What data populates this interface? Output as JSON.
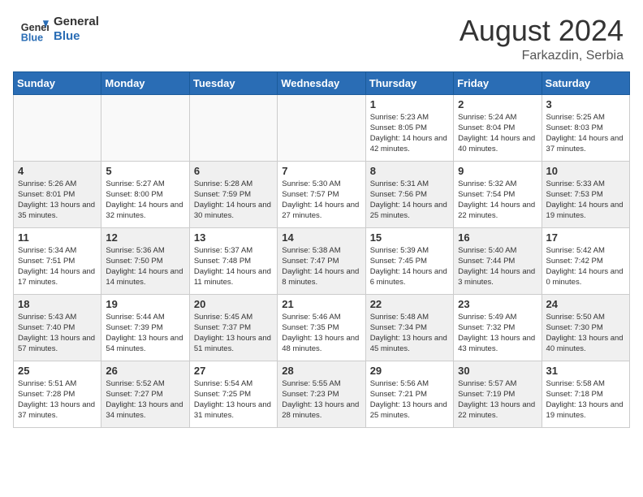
{
  "header": {
    "logo_line1": "General",
    "logo_line2": "Blue",
    "month_year": "August 2024",
    "location": "Farkazdin, Serbia"
  },
  "weekdays": [
    "Sunday",
    "Monday",
    "Tuesday",
    "Wednesday",
    "Thursday",
    "Friday",
    "Saturday"
  ],
  "weeks": [
    [
      {
        "day": "",
        "empty": true
      },
      {
        "day": "",
        "empty": true
      },
      {
        "day": "",
        "empty": true
      },
      {
        "day": "",
        "empty": true
      },
      {
        "day": "1",
        "sunrise": "5:23 AM",
        "sunset": "8:05 PM",
        "daylight": "14 hours and 42 minutes."
      },
      {
        "day": "2",
        "sunrise": "5:24 AM",
        "sunset": "8:04 PM",
        "daylight": "14 hours and 40 minutes."
      },
      {
        "day": "3",
        "sunrise": "5:25 AM",
        "sunset": "8:03 PM",
        "daylight": "14 hours and 37 minutes."
      }
    ],
    [
      {
        "day": "4",
        "sunrise": "5:26 AM",
        "sunset": "8:01 PM",
        "daylight": "13 hours and 35 minutes.",
        "shaded": true
      },
      {
        "day": "5",
        "sunrise": "5:27 AM",
        "sunset": "8:00 PM",
        "daylight": "14 hours and 32 minutes."
      },
      {
        "day": "6",
        "sunrise": "5:28 AM",
        "sunset": "7:59 PM",
        "daylight": "14 hours and 30 minutes.",
        "shaded": true
      },
      {
        "day": "7",
        "sunrise": "5:30 AM",
        "sunset": "7:57 PM",
        "daylight": "14 hours and 27 minutes."
      },
      {
        "day": "8",
        "sunrise": "5:31 AM",
        "sunset": "7:56 PM",
        "daylight": "14 hours and 25 minutes.",
        "shaded": true
      },
      {
        "day": "9",
        "sunrise": "5:32 AM",
        "sunset": "7:54 PM",
        "daylight": "14 hours and 22 minutes."
      },
      {
        "day": "10",
        "sunrise": "5:33 AM",
        "sunset": "7:53 PM",
        "daylight": "14 hours and 19 minutes.",
        "shaded": true
      }
    ],
    [
      {
        "day": "11",
        "sunrise": "5:34 AM",
        "sunset": "7:51 PM",
        "daylight": "14 hours and 17 minutes."
      },
      {
        "day": "12",
        "sunrise": "5:36 AM",
        "sunset": "7:50 PM",
        "daylight": "14 hours and 14 minutes.",
        "shaded": true
      },
      {
        "day": "13",
        "sunrise": "5:37 AM",
        "sunset": "7:48 PM",
        "daylight": "14 hours and 11 minutes."
      },
      {
        "day": "14",
        "sunrise": "5:38 AM",
        "sunset": "7:47 PM",
        "daylight": "14 hours and 8 minutes.",
        "shaded": true
      },
      {
        "day": "15",
        "sunrise": "5:39 AM",
        "sunset": "7:45 PM",
        "daylight": "14 hours and 6 minutes."
      },
      {
        "day": "16",
        "sunrise": "5:40 AM",
        "sunset": "7:44 PM",
        "daylight": "14 hours and 3 minutes.",
        "shaded": true
      },
      {
        "day": "17",
        "sunrise": "5:42 AM",
        "sunset": "7:42 PM",
        "daylight": "14 hours and 0 minutes."
      }
    ],
    [
      {
        "day": "18",
        "sunrise": "5:43 AM",
        "sunset": "7:40 PM",
        "daylight": "13 hours and 57 minutes.",
        "shaded": true
      },
      {
        "day": "19",
        "sunrise": "5:44 AM",
        "sunset": "7:39 PM",
        "daylight": "13 hours and 54 minutes."
      },
      {
        "day": "20",
        "sunrise": "5:45 AM",
        "sunset": "7:37 PM",
        "daylight": "13 hours and 51 minutes.",
        "shaded": true
      },
      {
        "day": "21",
        "sunrise": "5:46 AM",
        "sunset": "7:35 PM",
        "daylight": "13 hours and 48 minutes."
      },
      {
        "day": "22",
        "sunrise": "5:48 AM",
        "sunset": "7:34 PM",
        "daylight": "13 hours and 45 minutes.",
        "shaded": true
      },
      {
        "day": "23",
        "sunrise": "5:49 AM",
        "sunset": "7:32 PM",
        "daylight": "13 hours and 43 minutes."
      },
      {
        "day": "24",
        "sunrise": "5:50 AM",
        "sunset": "7:30 PM",
        "daylight": "13 hours and 40 minutes.",
        "shaded": true
      }
    ],
    [
      {
        "day": "25",
        "sunrise": "5:51 AM",
        "sunset": "7:28 PM",
        "daylight": "13 hours and 37 minutes."
      },
      {
        "day": "26",
        "sunrise": "5:52 AM",
        "sunset": "7:27 PM",
        "daylight": "13 hours and 34 minutes.",
        "shaded": true
      },
      {
        "day": "27",
        "sunrise": "5:54 AM",
        "sunset": "7:25 PM",
        "daylight": "13 hours and 31 minutes."
      },
      {
        "day": "28",
        "sunrise": "5:55 AM",
        "sunset": "7:23 PM",
        "daylight": "13 hours and 28 minutes.",
        "shaded": true
      },
      {
        "day": "29",
        "sunrise": "5:56 AM",
        "sunset": "7:21 PM",
        "daylight": "13 hours and 25 minutes."
      },
      {
        "day": "30",
        "sunrise": "5:57 AM",
        "sunset": "7:19 PM",
        "daylight": "13 hours and 22 minutes.",
        "shaded": true
      },
      {
        "day": "31",
        "sunrise": "5:58 AM",
        "sunset": "7:18 PM",
        "daylight": "13 hours and 19 minutes."
      }
    ]
  ],
  "labels": {
    "sunrise_label": "Sunrise:",
    "sunset_label": "Sunset:",
    "daylight_label": "Daylight:"
  }
}
